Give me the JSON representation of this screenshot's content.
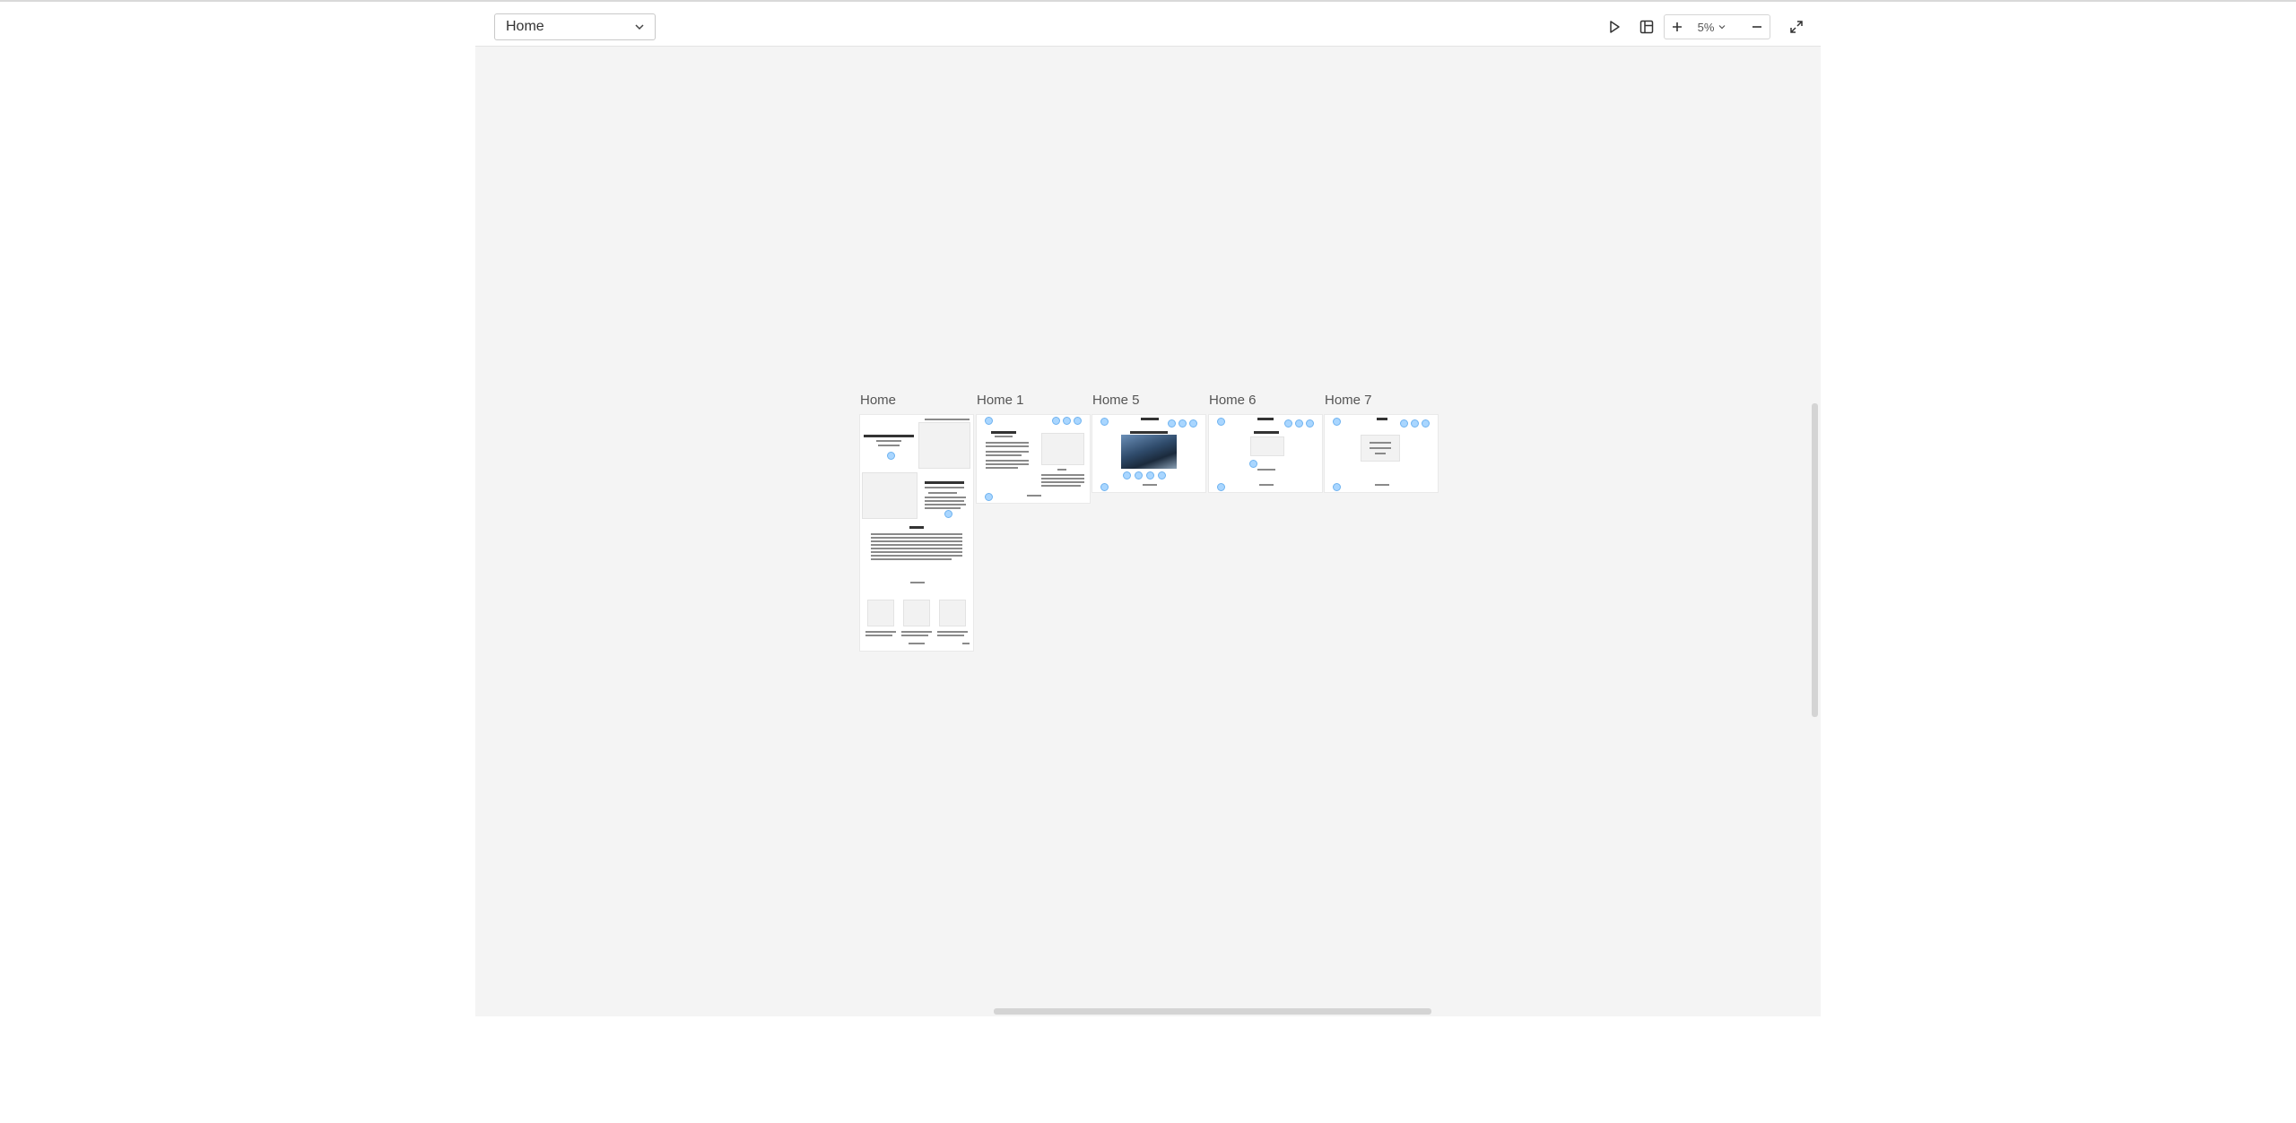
{
  "toolbar": {
    "page_select_value": "Home",
    "zoom_value": "5%",
    "icons": {
      "dropdown": "chevron-down-icon",
      "play": "play-icon",
      "layout": "layout-panel-icon",
      "zoom_in": "plus-icon",
      "zoom_out": "minus-icon",
      "fullscreen": "expand-icon"
    }
  },
  "canvas": {
    "pages": [
      {
        "label": "Home"
      },
      {
        "label": "Home 1"
      },
      {
        "label": "Home 5"
      },
      {
        "label": "Home 6"
      },
      {
        "label": "Home 7"
      }
    ]
  },
  "colors": {
    "canvas_bg": "#f4f4f4",
    "pin": "#a9d6ff"
  }
}
